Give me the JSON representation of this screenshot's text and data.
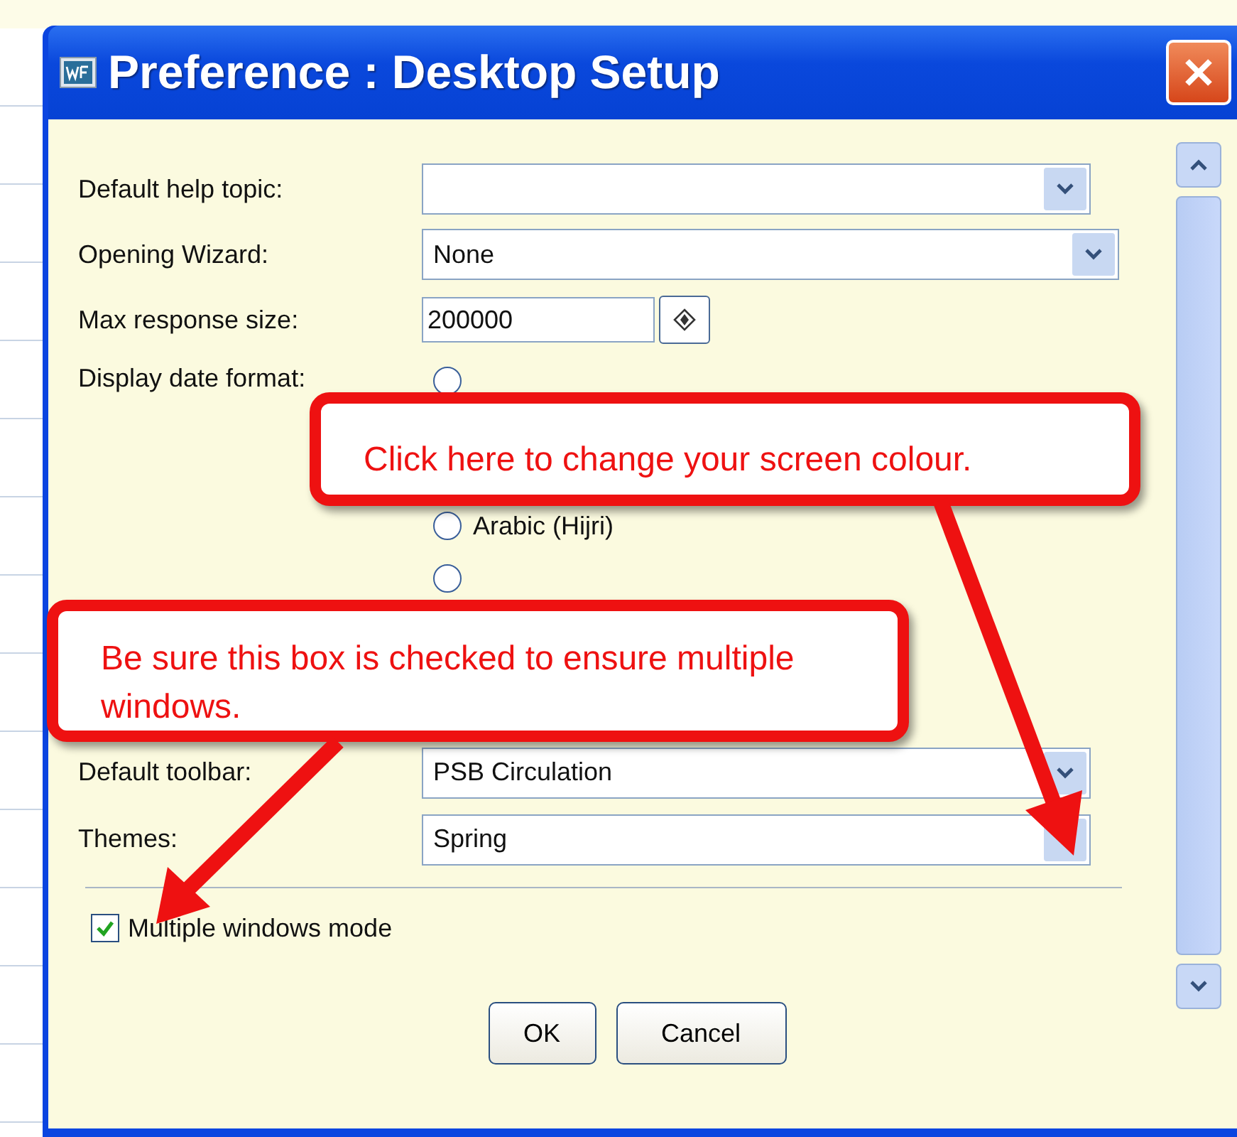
{
  "window": {
    "title": "Preference : Desktop Setup"
  },
  "fields": [
    {
      "label": "Default help topic:",
      "kind": "select",
      "wide": false
    },
    {
      "label": "Opening Wizard:",
      "kind": "select",
      "value": "None",
      "wide": true
    },
    {
      "label": "Max response size:",
      "kind": "number",
      "value": "200000"
    }
  ],
  "date_format": {
    "label": "Display date format:",
    "options": [
      {
        "selected": false
      },
      {
        "label": "Arabic (Hijri)",
        "selected": false
      },
      {
        "selected": false
      }
    ]
  },
  "lower_fields": [
    {
      "label": "Default toolbar:",
      "value": "PSB Circulation"
    },
    {
      "label": "Themes:",
      "value": "Spring"
    }
  ],
  "multiple_windows": {
    "label": "Multiple windows mode",
    "checked": true
  },
  "buttons": [
    "OK",
    "Cancel"
  ],
  "callouts": [
    {
      "text": "Click here to change your screen colour."
    },
    {
      "text": "Be sure this box is checked to ensure multiple windows."
    }
  ]
}
